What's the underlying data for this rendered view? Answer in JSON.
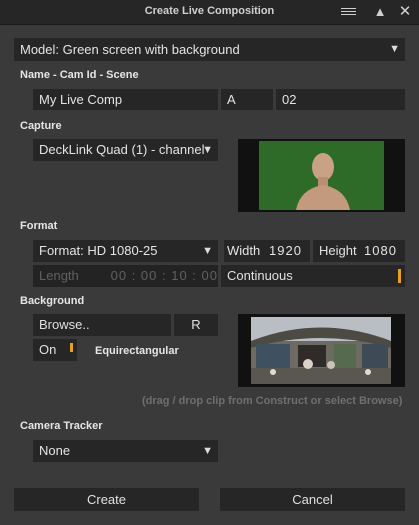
{
  "window": {
    "title": "Create Live Composition",
    "menu_icon": "hamburger-menu-icon",
    "maximize_icon": "triangle-up-icon",
    "close_icon": "close-x-icon"
  },
  "model": {
    "selected": "Model: Green screen with background"
  },
  "name_section": {
    "label": "Name - Cam Id - Scene",
    "name_value": "My Live Comp",
    "cam_id_value": "A",
    "scene_value": "02"
  },
  "capture": {
    "label": "Capture",
    "device_selected": "DeckLink Quad (1) - channel"
  },
  "format": {
    "label": "Format",
    "format_selected": "Format: HD 1080-25",
    "width_label": "Width",
    "width_value": "1920",
    "height_label": "Height",
    "height_value": "1080",
    "length_label": "Length",
    "length_value": "00 : 00 : 10 : 00",
    "continuous_label": "Continuous"
  },
  "background": {
    "label": "Background",
    "browse_label": "Browse..",
    "reset_label": "R",
    "toggle_label": "On",
    "projection_label": "Equirectangular",
    "hint": "(drag / drop clip from Construct or select Browse)"
  },
  "camera_tracker": {
    "label": "Camera Tracker",
    "selected": "None"
  },
  "actions": {
    "create_label": "Create",
    "cancel_label": "Cancel"
  },
  "colors": {
    "background": "#3a3a3a",
    "field": "#262626",
    "accent_orange": "#e8a020",
    "green_screen": "#2f6b28"
  }
}
